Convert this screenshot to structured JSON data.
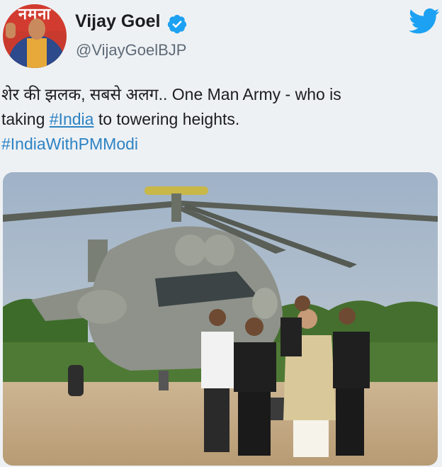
{
  "tweet": {
    "author_name": "Vijay Goel",
    "author_handle": "@VijayGoelBJP",
    "avatar_banner_text": "नमना",
    "text_part1": "शेर की झलक, सबसे अलग.. One Man Army - who is",
    "text_part2_prefix": "taking ",
    "hashtag_india": "#India",
    "text_part2_suffix": " to towering heights.",
    "hashtag_with_pm": "#IndiaWithPMModi"
  },
  "icons": {
    "verified": "verified-badge-icon",
    "brand": "twitter-bird-icon"
  },
  "colors": {
    "background": "#eef1f4",
    "text": "#1b1d20",
    "handle": "#5e6a76",
    "link": "#2d83c4",
    "twitter_blue": "#1da1f2"
  }
}
